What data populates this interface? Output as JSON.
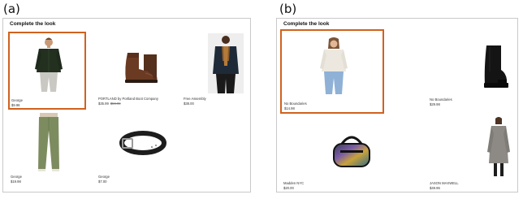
{
  "panels": {
    "a": {
      "label": "(a)",
      "title": "Complete the look",
      "items": [
        {
          "brand": "George",
          "price": "$9.98",
          "strike": "",
          "icon": "shirt-model-photo"
        },
        {
          "brand": "PORTLAND by Portland Boot Company",
          "price": "$35.99",
          "strike": "$59.99",
          "icon": "brown-boot-photo"
        },
        {
          "brand": "Free Assembly",
          "price": "$38.00",
          "strike": "",
          "icon": "jacket-model-photo"
        },
        {
          "brand": "George",
          "price": "$19.98",
          "strike": "",
          "icon": "green-pants-photo"
        },
        {
          "brand": "George",
          "price": "$7.00",
          "strike": "",
          "icon": "black-belt-photo"
        }
      ]
    },
    "b": {
      "label": "(b)",
      "title": "Complete the look",
      "items": [
        {
          "brand": "No Boundaries",
          "price": "$14.98",
          "icon": "sweater-model-photo"
        },
        {
          "brand": "No Boundaries",
          "price": "$29.98",
          "icon": "black-boot-photo"
        },
        {
          "brand": "Madden NYC",
          "price": "$20.00",
          "icon": "iridescent-bag-photo"
        },
        {
          "brand": "JASON MAXWELL",
          "price": "$49.96",
          "icon": "gray-coat-model-photo"
        }
      ]
    }
  },
  "colors": {
    "selection_border": "#d0621e",
    "panel_border": "#c9c9c9"
  }
}
